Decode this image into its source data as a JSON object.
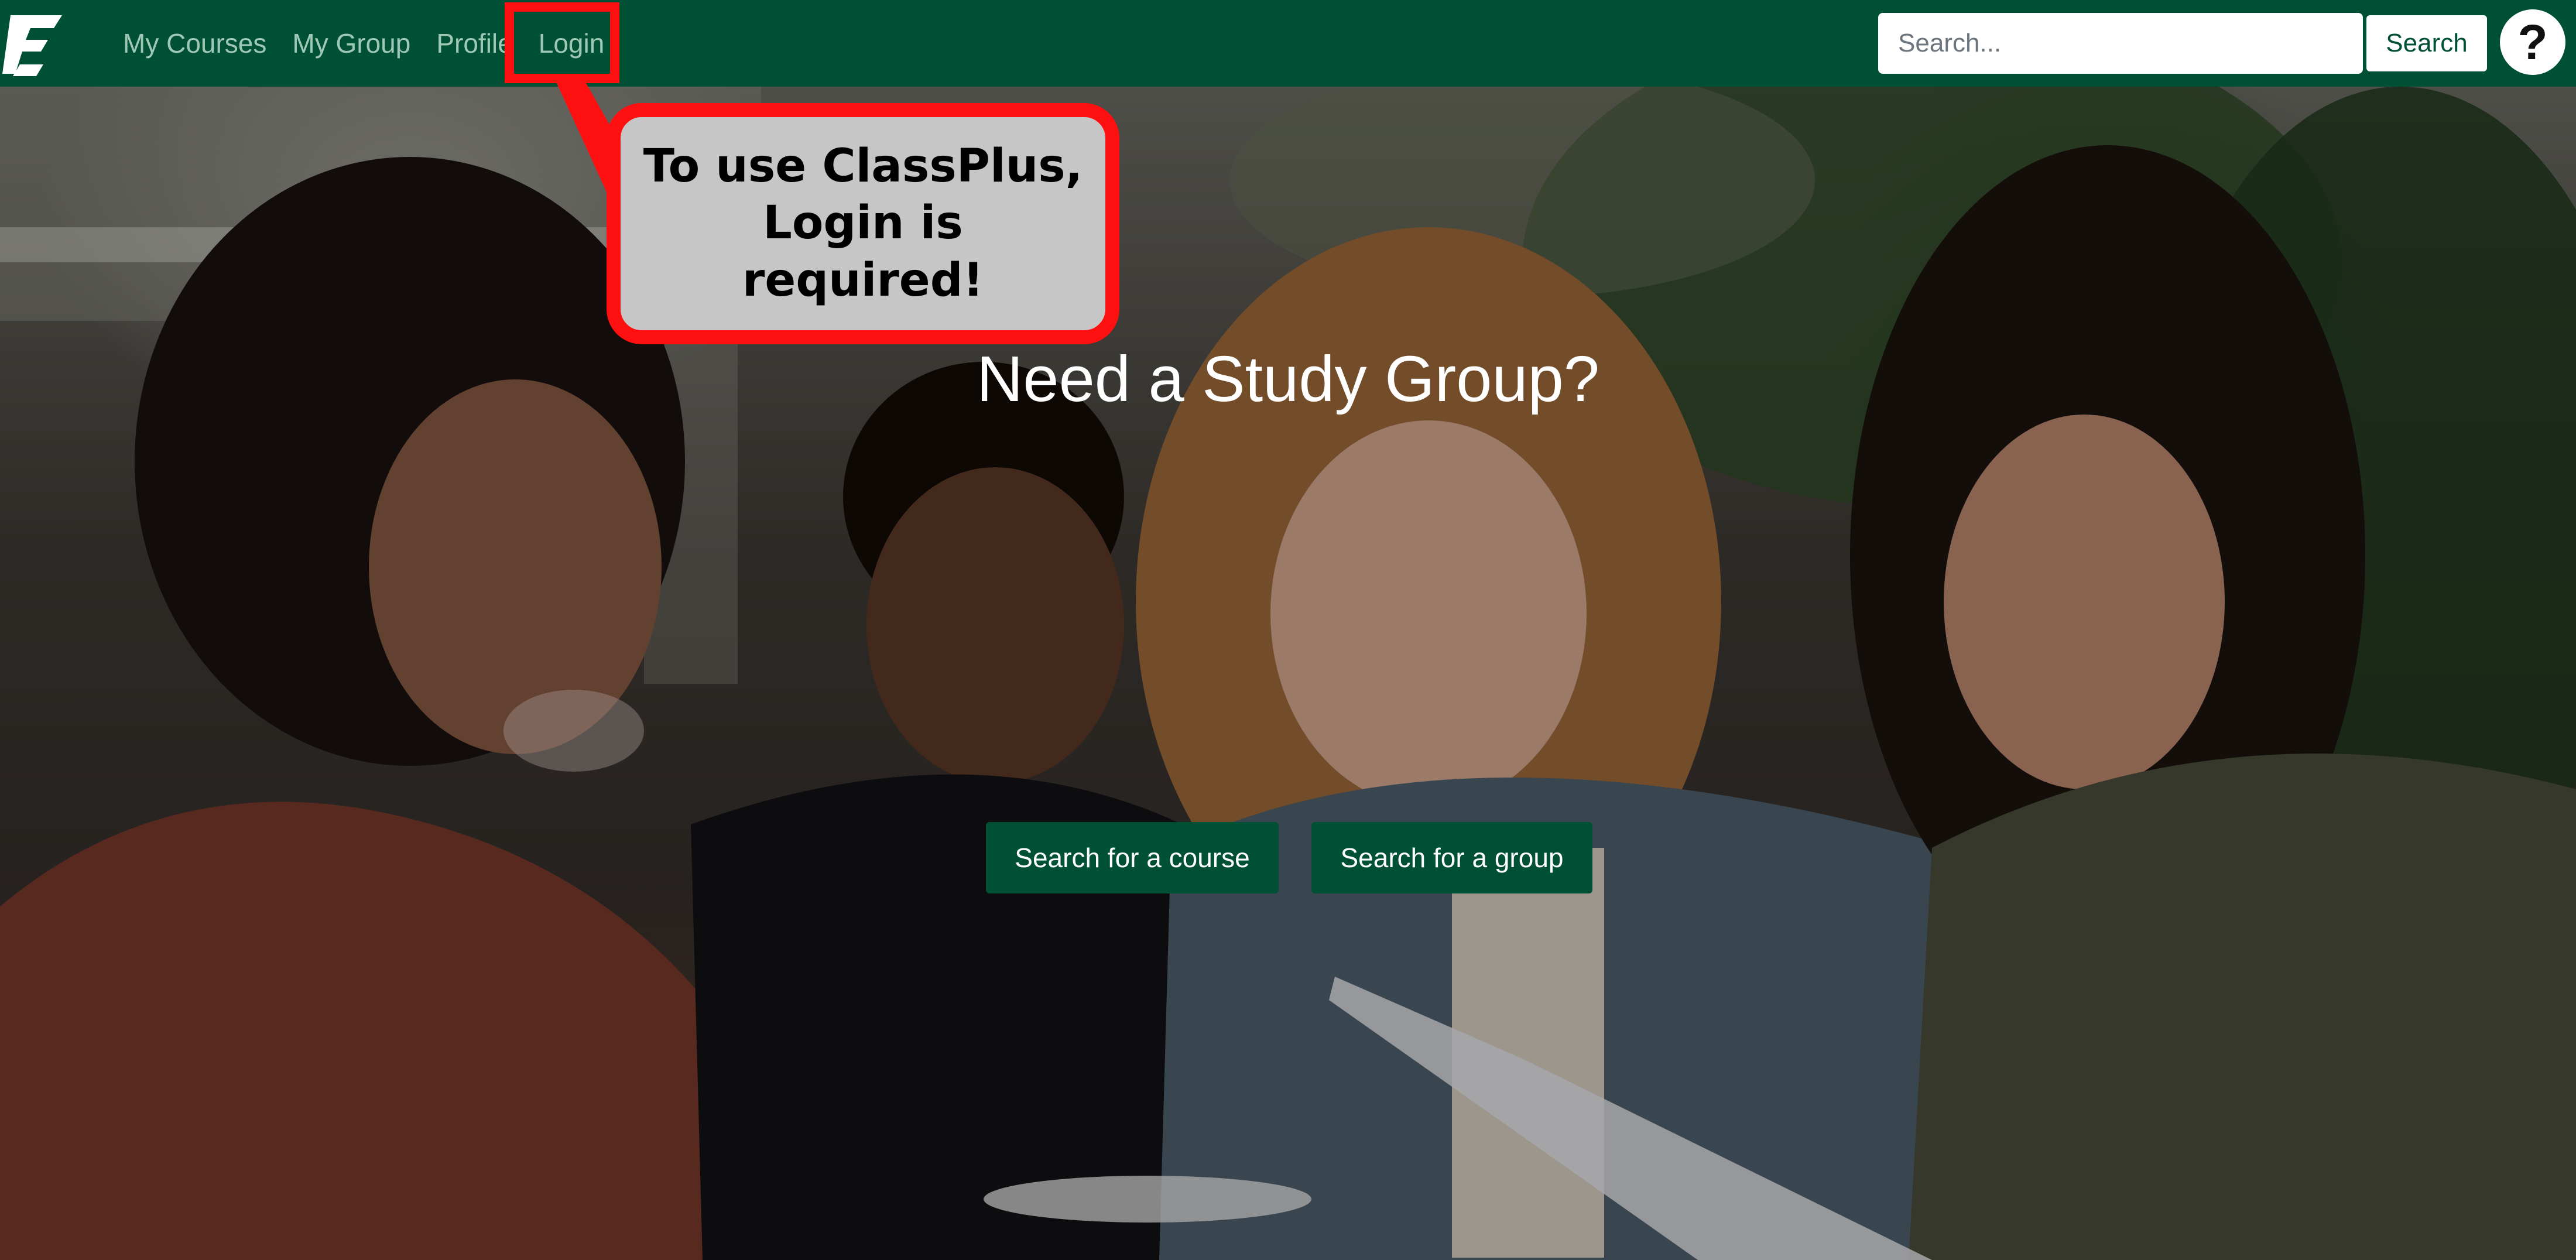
{
  "navbar": {
    "logo_icon": "university-logo-icon",
    "links": {
      "my_courses": "My Courses",
      "my_group": "My Group",
      "profile": "Profile",
      "login": "Login"
    },
    "search": {
      "placeholder": "Search...",
      "button_label": "Search"
    },
    "help_label": "?"
  },
  "hero": {
    "title": "Need a Study Group?",
    "buttons": {
      "search_course": "Search for a course",
      "search_group": "Search for a group"
    }
  },
  "callout": {
    "text": "To use ClassPlus, Login is required!"
  },
  "colors": {
    "brand_green": "#005035",
    "highlight_red": "#ff1010",
    "callout_gray": "#c6c6c6"
  }
}
